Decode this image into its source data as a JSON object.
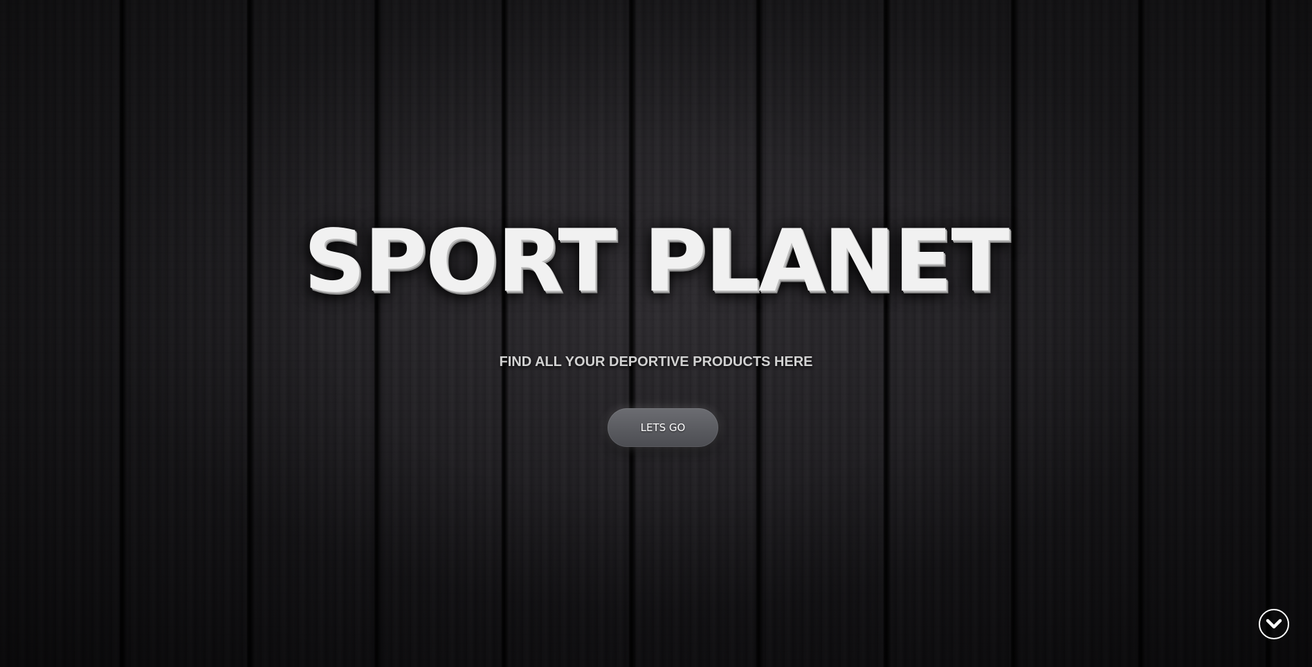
{
  "hero": {
    "title": "SPORT PLANET",
    "subtitle": "FIND ALL YOUR DEPORTIVE PRODUCTS HERE",
    "cta_label": "LETS GO"
  },
  "scroll_button": {
    "icon": "chevron-down-circle-icon"
  },
  "colors": {
    "background": "#1a191c",
    "title": "#f1f1f1",
    "subtitle": "#d2d2d2",
    "button": "#5f6065"
  }
}
